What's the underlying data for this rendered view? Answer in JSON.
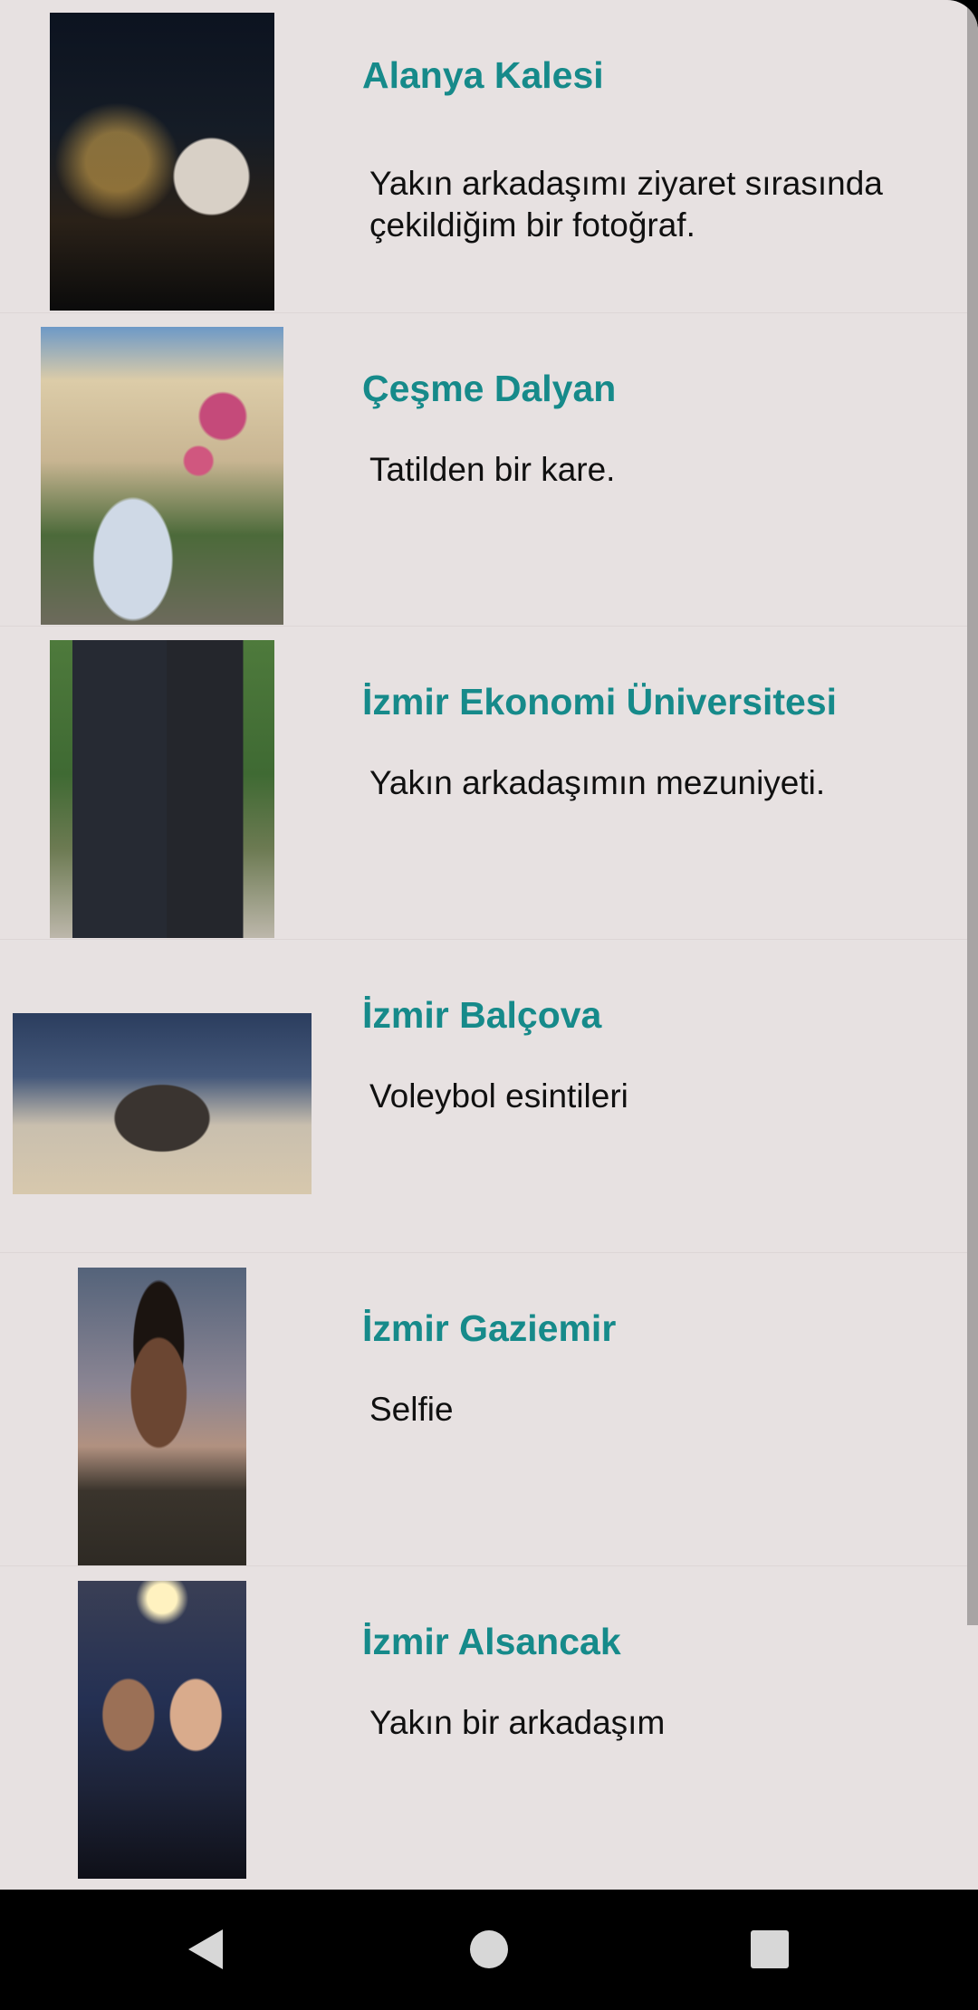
{
  "items": [
    {
      "title": "Alanya Kalesi",
      "description": "Yakın arkadaşımı ziyaret sırasında çekildiğim bir fotoğraf.",
      "photo": "night-castle-photo"
    },
    {
      "title": "Çeşme Dalyan",
      "description": "Tatilden bir kare.",
      "photo": "holiday-house-photo"
    },
    {
      "title": "İzmir Ekonomi Üniversitesi",
      "description": "Yakın arkadaşımın mezuniyeti.",
      "photo": "graduation-photo"
    },
    {
      "title": "İzmir Balçova",
      "description": "Voleybol esintileri",
      "photo": "volleyball-group-photo"
    },
    {
      "title": "İzmir Gaziemir",
      "description": "Selfie",
      "photo": "selfie-photo"
    },
    {
      "title": "İzmir Alsancak",
      "description": "Yakın bir arkadaşım",
      "photo": "friends-selfie-photo"
    }
  ],
  "navigation": {
    "back": "back-icon",
    "home": "home-icon",
    "recents": "recents-icon"
  }
}
